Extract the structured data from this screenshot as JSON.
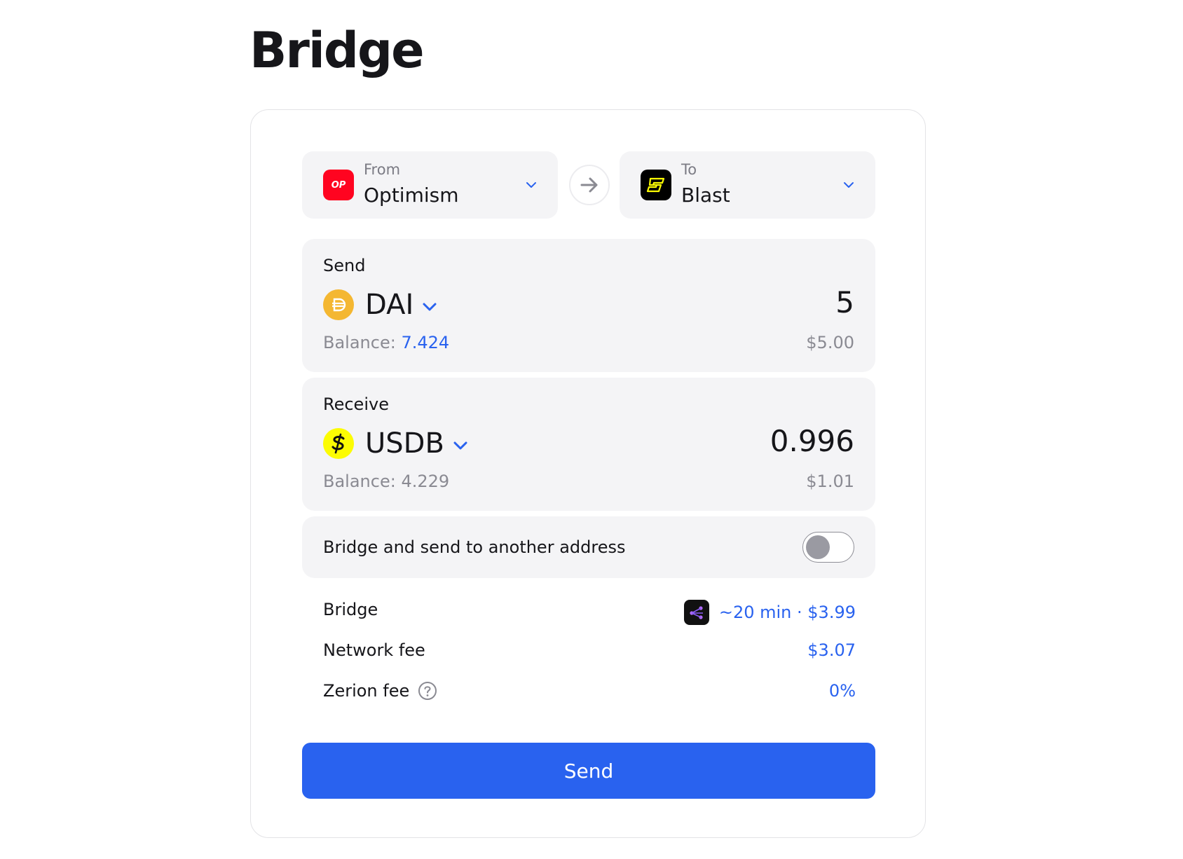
{
  "page": {
    "title": "Bridge"
  },
  "chains": {
    "from": {
      "caption": "From",
      "name": "Optimism",
      "logo_text": "OP",
      "icon": "optimism-logo",
      "color": "#ff0420"
    },
    "to": {
      "caption": "To",
      "name": "Blast",
      "icon": "blast-logo",
      "color": "#fcfc03"
    }
  },
  "send": {
    "label": "Send",
    "token": {
      "symbol": "DAI",
      "icon": "dai-icon",
      "color": "#f4b731"
    },
    "amount": "5",
    "balance_label": "Balance: ",
    "balance_value": "7.424",
    "usd_value": "$5.00"
  },
  "receive": {
    "label": "Receive",
    "token": {
      "symbol": "USDB",
      "icon": "usdb-icon",
      "color": "#fcfc03"
    },
    "amount": "0.996",
    "balance_label": "Balance: ",
    "balance_value": "4.229",
    "usd_value": "$1.01"
  },
  "toggle": {
    "label": "Bridge and send to another address",
    "enabled": false
  },
  "details": {
    "bridge": {
      "label": "Bridge",
      "value": "~20 min · $3.99"
    },
    "network_fee": {
      "label": "Network fee",
      "value": "$3.07"
    },
    "zerion_fee": {
      "label": "Zerion fee",
      "value": "0%"
    }
  },
  "actions": {
    "send_label": "Send"
  },
  "colors": {
    "accent": "#2962ef",
    "panel": "#f4f4f6"
  }
}
